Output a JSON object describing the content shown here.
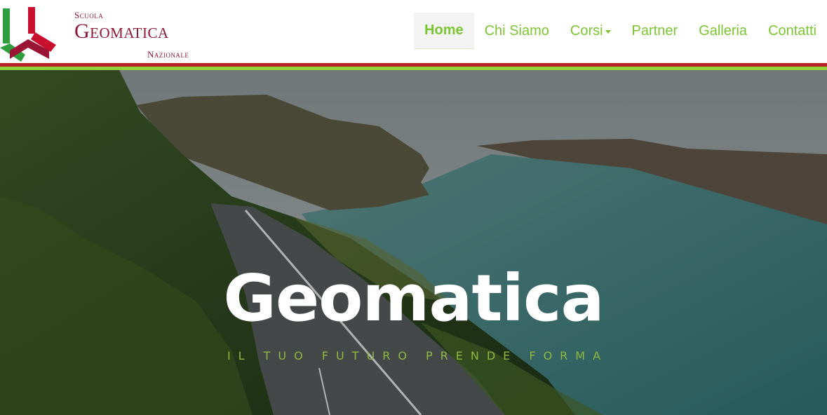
{
  "logo": {
    "line1": "Scuola",
    "line2": "Geomatica",
    "line3": "Nazionale",
    "colors": {
      "red": "#c8102e",
      "green": "#2e9e3e",
      "maroon": "#8f1634"
    }
  },
  "nav": {
    "items": [
      {
        "label": "Home",
        "active": true
      },
      {
        "label": "Chi Siamo"
      },
      {
        "label": "Corsi",
        "dropdown": true
      },
      {
        "label": "Partner"
      },
      {
        "label": "Galleria"
      },
      {
        "label": "Contatti"
      }
    ],
    "accent": "#7cc532"
  },
  "hero": {
    "title": "Geomatica",
    "subtitle": "Il tuo futuro prende forma"
  }
}
